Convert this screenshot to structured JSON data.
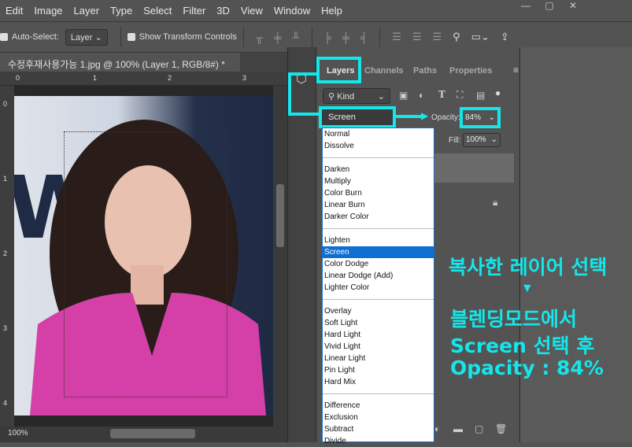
{
  "menu": [
    "Edit",
    "Image",
    "Layer",
    "Type",
    "Select",
    "Filter",
    "3D",
    "View",
    "Window",
    "Help"
  ],
  "options": {
    "auto_select": "Auto-Select:",
    "layer_select": "Layer",
    "show_transform": "Show Transform Controls"
  },
  "document": {
    "tab_title": "수정후재사용가능 1.jpg @ 100% (Layer 1, RGB/8#) *",
    "close": "×",
    "zoom": "100%",
    "ruler_top": [
      "0",
      "1",
      "2",
      "3"
    ],
    "ruler_left": [
      "0",
      "1",
      "2",
      "3",
      "4"
    ]
  },
  "panel": {
    "tabs": [
      "Layers",
      "Channels",
      "Paths",
      "Properties"
    ],
    "kind": "Kind",
    "blend_mode": "Screen",
    "opacity_label": "Opacity:",
    "opacity": "84%",
    "fill_label": "Fill:",
    "fill": "100%"
  },
  "blend_groups": [
    [
      "Normal",
      "Dissolve"
    ],
    [
      "Darken",
      "Multiply",
      "Color Burn",
      "Linear Burn",
      "Darker Color"
    ],
    [
      "Lighten",
      "Screen",
      "Color Dodge",
      "Linear Dodge (Add)",
      "Lighter Color"
    ],
    [
      "Overlay",
      "Soft Light",
      "Hard Light",
      "Vivid Light",
      "Linear Light",
      "Pin Light",
      "Hard Mix"
    ],
    [
      "Difference",
      "Exclusion",
      "Subtract",
      "Divide"
    ]
  ],
  "selected_mode": "Screen",
  "annotation": {
    "line1": "복사한 레이어 선택",
    "arrow": "▼",
    "line2": "블렌딩모드에서",
    "line3": "Screen 선택 후",
    "line4": "Opacity : 84%"
  },
  "colors": {
    "highlight": "#14e6ea",
    "selection": "#0e6ed2"
  }
}
